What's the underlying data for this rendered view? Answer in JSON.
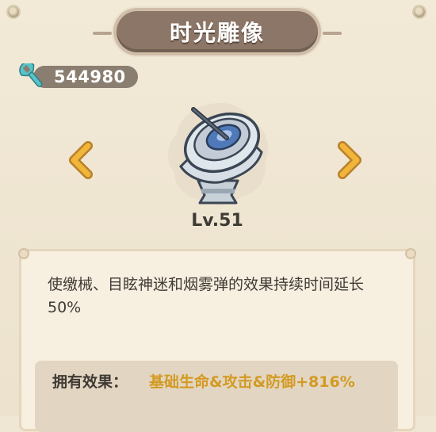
{
  "header": {
    "title": "时光雕像"
  },
  "currency": {
    "value": "544980",
    "icon": "wrench-icon",
    "icon_color": "#58c3c8"
  },
  "nav": {
    "prev_icon": "chevron-left-icon",
    "next_icon": "chevron-right-icon",
    "arrow_color": "#e2a52b"
  },
  "item": {
    "icon": "sundial-artifact-icon",
    "level": "Lv.51"
  },
  "description": {
    "text": "使缴械、目眩神迷和烟雾弹的效果持续时间延长50%",
    "effect_label": "拥有效果：",
    "effect_value": "基础生命&攻击&防御+816%",
    "effect_value_color": "#d39a23"
  }
}
